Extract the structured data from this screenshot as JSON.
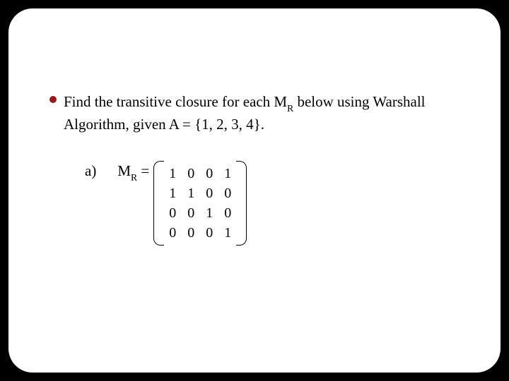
{
  "problem": {
    "text_before_sub": "Find the transitive closure for each M",
    "sub": "R",
    "text_after_sub": " below using Warshall Algorithm, given A = {1, 2, 3, 4}."
  },
  "part": {
    "label": "a)",
    "mr_before": "M",
    "mr_sub": "R",
    "mr_after": " ="
  },
  "chart_data": {
    "type": "table",
    "title": "Boolean matrix M_R for Warshall algorithm exercise (part a)",
    "rows": 4,
    "cols": 4,
    "values": [
      [
        1,
        0,
        0,
        1
      ],
      [
        1,
        1,
        0,
        0
      ],
      [
        0,
        0,
        1,
        0
      ],
      [
        0,
        0,
        0,
        1
      ]
    ]
  }
}
